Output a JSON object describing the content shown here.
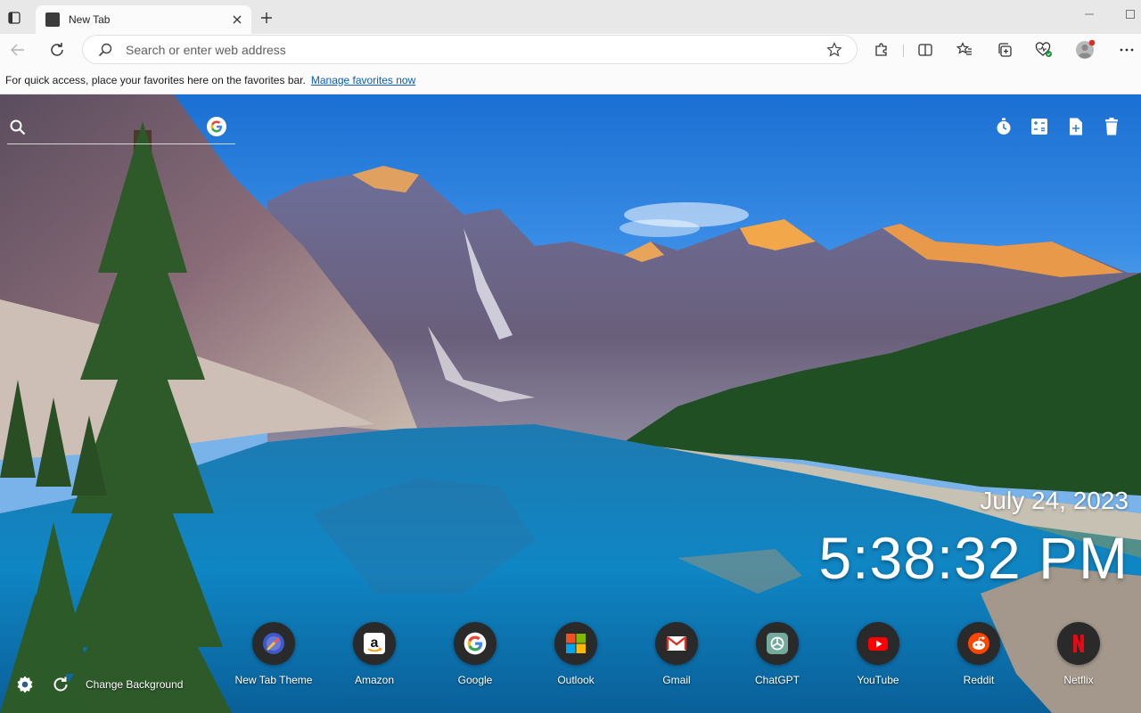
{
  "browser": {
    "tab": {
      "title": "New Tab"
    },
    "omnibox": {
      "placeholder": "Search or enter web address"
    }
  },
  "favorites_bar": {
    "message": "For quick access, place your favorites here on the favorites bar.",
    "link": "Manage favorites now"
  },
  "ntp": {
    "date": "July 24, 2023",
    "time": "5:38:32 PM",
    "search_engine": "google-icon",
    "top_tools": [
      "timer-icon",
      "calculator-icon",
      "new-note-icon",
      "trash-icon"
    ],
    "shortcuts": [
      {
        "label": "New Tab Theme",
        "icon": "new-tab-theme-icon"
      },
      {
        "label": "Amazon",
        "icon": "amazon-icon"
      },
      {
        "label": "Google",
        "icon": "google-icon"
      },
      {
        "label": "Outlook",
        "icon": "outlook-icon"
      },
      {
        "label": "Gmail",
        "icon": "gmail-icon"
      },
      {
        "label": "ChatGPT",
        "icon": "chatgpt-icon"
      },
      {
        "label": "YouTube",
        "icon": "youtube-icon"
      },
      {
        "label": "Reddit",
        "icon": "reddit-icon"
      },
      {
        "label": "Netflix",
        "icon": "netflix-icon"
      }
    ],
    "change_background_label": "Change Background"
  },
  "colors": {
    "link": "#0a5db8",
    "profile_notification": "#d93025"
  }
}
